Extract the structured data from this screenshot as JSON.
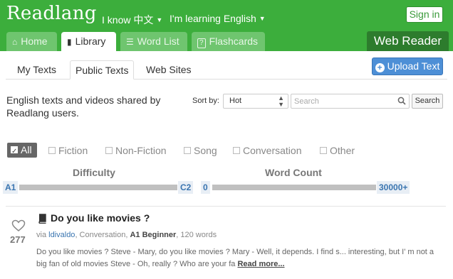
{
  "header": {
    "logo": "Readlang",
    "i_know": "I know 中文",
    "learning": "I'm learning English",
    "sign_in": "Sign in",
    "web_reader": "Web Reader"
  },
  "tabs": [
    {
      "label": "Home",
      "icon": "home-icon"
    },
    {
      "label": "Library",
      "icon": "book-icon"
    },
    {
      "label": "Word List",
      "icon": "list-icon"
    },
    {
      "label": "Flashcards",
      "icon": "question-icon"
    }
  ],
  "subtabs": [
    "My Texts",
    "Public Texts",
    "Web Sites"
  ],
  "upload_label": "Upload Text",
  "intro": "English texts and videos shared by Readlang users.",
  "sort": {
    "label": "Sort by:",
    "value": "Hot"
  },
  "search": {
    "placeholder": "Search",
    "button": "Search"
  },
  "filters": [
    "All",
    "Fiction",
    "Non-Fiction",
    "Song",
    "Conversation",
    "Other"
  ],
  "difficulty": {
    "title": "Difficulty",
    "min": "A1",
    "max": "C2"
  },
  "word_count": {
    "title": "Word Count",
    "min": "0",
    "max": "30000+"
  },
  "item": {
    "likes": "277",
    "title": "Do you like movies ?",
    "via": "via",
    "author": "ldivaldo",
    "category": ", Conversation, ",
    "level": "A1 Beginner",
    "words": ", 120 words",
    "excerpt": "Do you like movies ? Steve - Mary, do you like movies ? Mary - Well, it depends. I find s... interesting, but I' m not a big fan of old movies Steve - Oh, really ? Who are your fa",
    "read_more": "Read more..."
  },
  "colors": {
    "brand": "#3cae3c",
    "dark_brand": "#2d7c2d",
    "accent_blue": "#4d8fd6"
  }
}
